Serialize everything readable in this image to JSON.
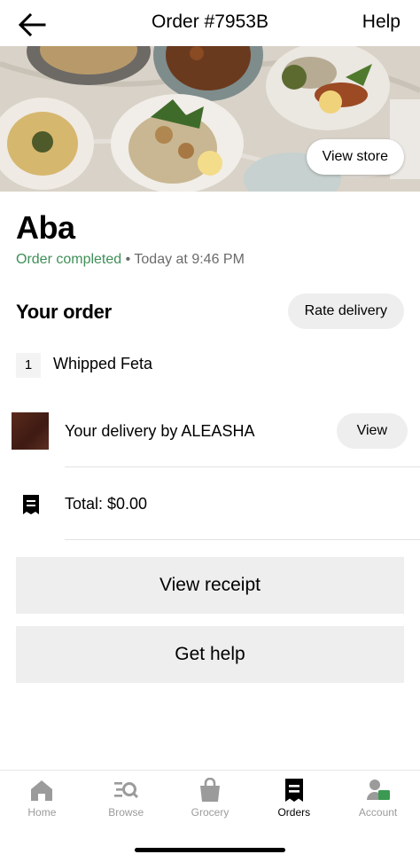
{
  "header": {
    "title": "Order #7953B",
    "help_label": "Help"
  },
  "hero": {
    "view_store_label": "View store"
  },
  "store": {
    "name": "Aba",
    "status": "Order completed",
    "separator": "•",
    "time": "Today at 9:46 PM"
  },
  "order": {
    "heading": "Your order",
    "rate_label": "Rate delivery",
    "items": [
      {
        "qty": "1",
        "name": "Whipped Feta"
      }
    ]
  },
  "delivery": {
    "text": "Your delivery by ALEASHA",
    "view_label": "View"
  },
  "total": {
    "text": "Total: $0.00"
  },
  "actions": {
    "receipt_label": "View receipt",
    "help_label": "Get help"
  },
  "tabs": [
    {
      "label": "Home",
      "icon": "home-icon"
    },
    {
      "label": "Browse",
      "icon": "browse-icon"
    },
    {
      "label": "Grocery",
      "icon": "grocery-icon"
    },
    {
      "label": "Orders",
      "icon": "orders-icon",
      "active": true
    },
    {
      "label": "Account",
      "icon": "account-icon"
    }
  ],
  "colors": {
    "completed": "#3e8f57",
    "muted": "#6b6b6b",
    "pill_bg": "#eeeeee",
    "tab_inactive": "#9b9b9b"
  }
}
